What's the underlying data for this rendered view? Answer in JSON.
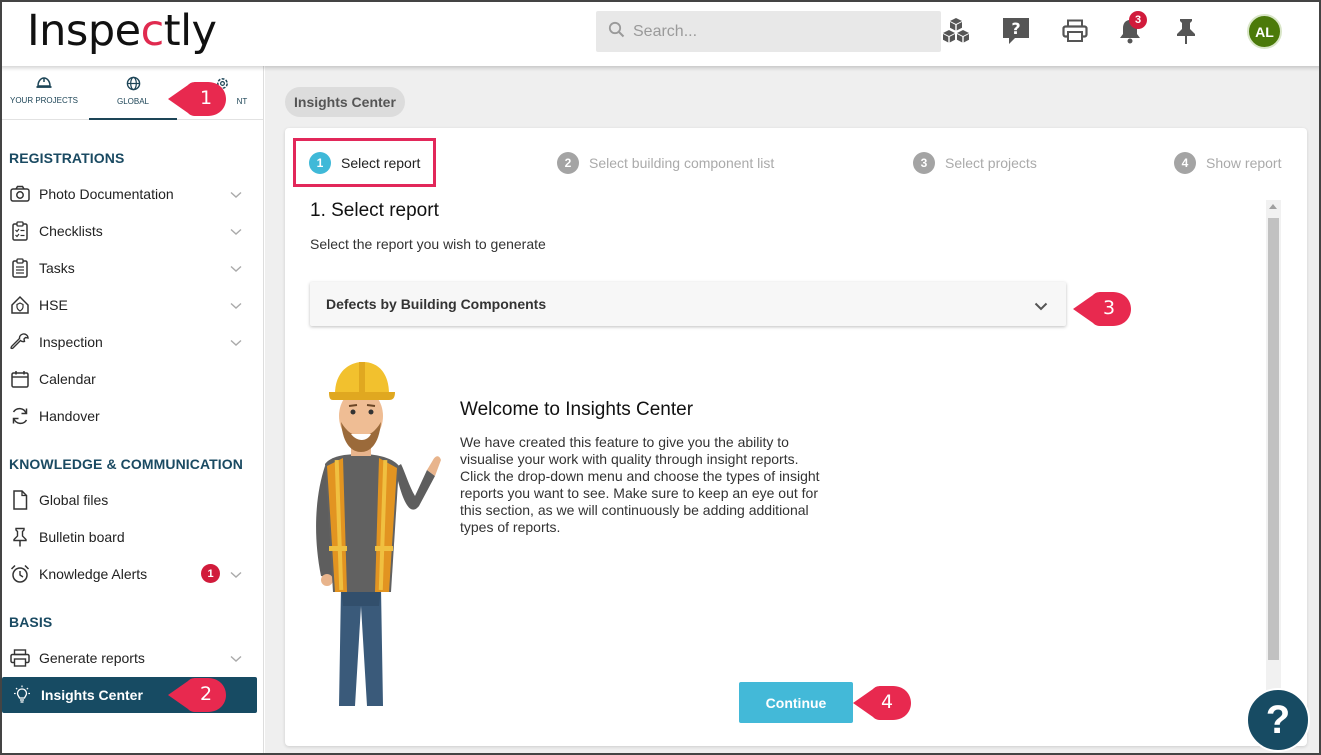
{
  "header": {
    "logo_text_1": "Inspe",
    "logo_text_accent": "c",
    "logo_text_2": "tly",
    "search_placeholder": "Search...",
    "icons": [
      "cubes-icon",
      "help-chat-icon",
      "print-icon",
      "bell-icon",
      "pin-icon"
    ],
    "notifications_count": "3",
    "avatar_initials": "AL"
  },
  "sidebar": {
    "tabs": [
      {
        "label": "YOUR PROJECTS",
        "icon": "hardhat-icon"
      },
      {
        "label": "GLOBAL",
        "icon": "globe-icon"
      },
      {
        "label": "NT",
        "icon": "gear-icon"
      }
    ],
    "active_tab": "GLOBAL",
    "sections": [
      {
        "title": "REGISTRATIONS",
        "items": [
          "Photo Documentation",
          "Checklists",
          "Tasks",
          "HSE",
          "Inspection",
          "Calendar",
          "Handover"
        ]
      },
      {
        "title": "KNOWLEDGE & COMMUNICATION",
        "items": [
          "Global files",
          "Bulletin board",
          "Knowledge Alerts"
        ]
      },
      {
        "title": "BASIS",
        "items": [
          "Generate reports",
          "Insights Center"
        ]
      }
    ],
    "knowledge_alerts_badge": "1",
    "active_item": "Insights Center"
  },
  "main": {
    "breadcrumb": "Insights Center",
    "steps": [
      {
        "num": "1",
        "label": "Select report"
      },
      {
        "num": "2",
        "label": "Select building component list"
      },
      {
        "num": "3",
        "label": "Select projects"
      },
      {
        "num": "4",
        "label": "Show report"
      }
    ],
    "heading": "1. Select report",
    "subheading": "Select the report you wish to generate",
    "selected_report": "Defects by Building Components",
    "welcome_title": "Welcome to Insights Center",
    "welcome_lines": [
      "We have created this feature to give you the ability to",
      "visualise your work with quality through insight reports.",
      "Click the drop-down menu and choose the types of insight",
      "reports you want to see. Make sure to keep an eye out for",
      "this section, as we will continuously be adding additional",
      "types of reports."
    ],
    "continue_label": "Continue"
  },
  "callouts": [
    "1",
    "2",
    "3",
    "4"
  ],
  "help_label": "?",
  "colors": {
    "accent": "#43b9d8",
    "nav_active": "#174b63",
    "highlight": "#e2285a",
    "badge": "#d11b3b",
    "callout": "#e8294f"
  }
}
